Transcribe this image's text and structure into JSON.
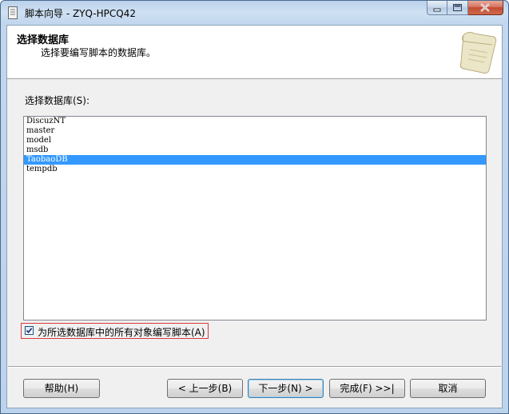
{
  "window": {
    "title": "脚本向导 - ZYQ-HPCQ42"
  },
  "header": {
    "title": "选择数据库",
    "subtitle": "选择要编写脚本的数据库。"
  },
  "database_list": {
    "label": "选择数据库(S):",
    "items": [
      "DiscuzNT",
      "master",
      "model",
      "msdb",
      "TaobaoDB",
      "tempdb"
    ],
    "selected": "TaobaoDB"
  },
  "options": {
    "script_all_objects_label": "为所选数据库中的所有对象编写脚本(A)",
    "script_all_objects_checked": true
  },
  "buttons": {
    "help": "帮助(H)",
    "back": "< 上一步(B)",
    "next": "下一步(N) >",
    "finish": "完成(F) >>|",
    "cancel": "取消"
  },
  "colors": {
    "selection": "#3399ff",
    "highlight_border": "#d83a3a"
  }
}
